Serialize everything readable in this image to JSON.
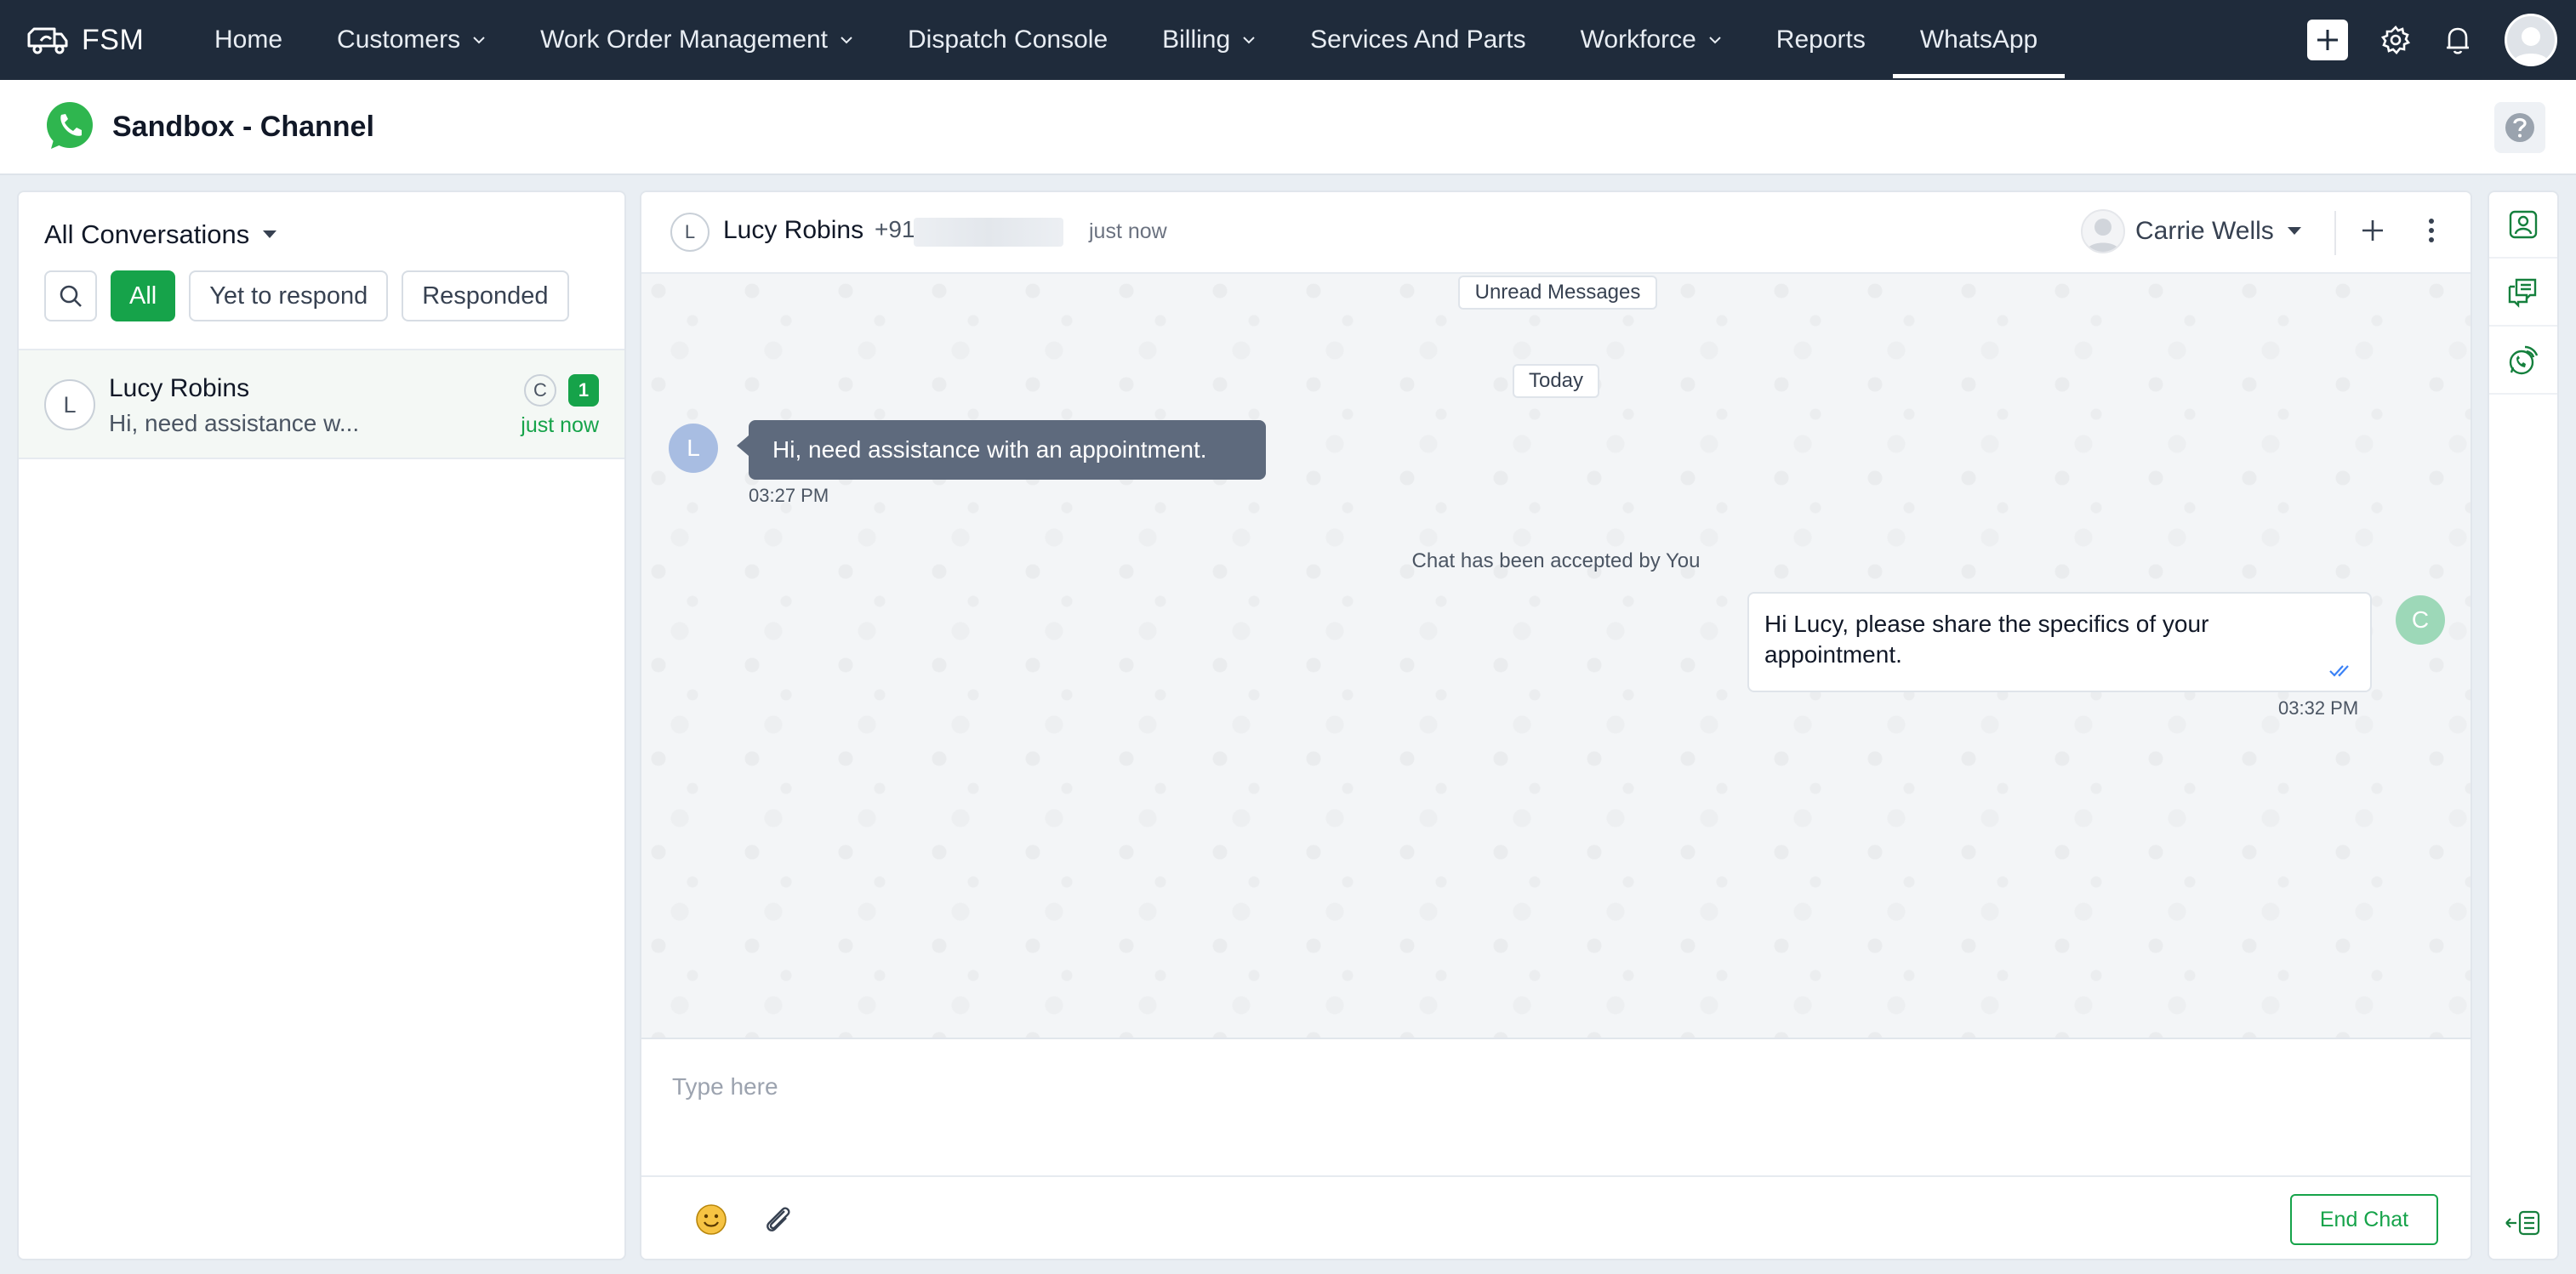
{
  "app": {
    "brand": "FSM",
    "logo_icon": "truck-logo-icon"
  },
  "nav": {
    "items": [
      {
        "label": "Home",
        "has_caret": false
      },
      {
        "label": "Customers",
        "has_caret": true
      },
      {
        "label": "Work Order Management",
        "has_caret": true
      },
      {
        "label": "Dispatch Console",
        "has_caret": false
      },
      {
        "label": "Billing",
        "has_caret": true
      },
      {
        "label": "Services And Parts",
        "has_caret": false
      },
      {
        "label": "Workforce",
        "has_caret": true
      },
      {
        "label": "Reports",
        "has_caret": false
      },
      {
        "label": "WhatsApp",
        "has_caret": false,
        "active": true
      }
    ],
    "right_icons": [
      "plus-icon",
      "gear-icon",
      "bell-icon",
      "avatar"
    ]
  },
  "subheader": {
    "title": "Sandbox - Channel",
    "icon": "whatsapp-icon",
    "help_icon": "help-icon"
  },
  "conversations": {
    "filter_label": "All Conversations",
    "filters": [
      "All",
      "Yet to respond",
      "Responded"
    ],
    "active_filter": "All",
    "items": [
      {
        "initial": "L",
        "name": "Lucy Robins",
        "preview": "Hi, need assistance w...",
        "agent_initial": "C",
        "unread": "1",
        "time": "just now"
      }
    ]
  },
  "chat": {
    "contact": {
      "initial": "L",
      "name": "Lucy Robins",
      "phone_prefix": "+91",
      "time": "just now"
    },
    "assignee": "Carrie Wells",
    "unread_marker": "Unread Messages",
    "date_marker": "Today",
    "messages": [
      {
        "direction": "in",
        "initial": "L",
        "text": "Hi, need assistance with an appointment.",
        "time": "03:27 PM"
      },
      {
        "direction": "system",
        "text": "Chat has been accepted by You"
      },
      {
        "direction": "out",
        "initial": "C",
        "text": "Hi Lucy, please share the specifics of your appointment.",
        "time": "03:32 PM",
        "status": "read"
      }
    ],
    "composer": {
      "placeholder": "Type here",
      "end_chat_label": "End Chat"
    }
  },
  "right_rail": {
    "icons": [
      "contact-icon",
      "chat-notes-icon",
      "whatsapp-template-icon",
      "collapse-panel-icon"
    ]
  },
  "colors": {
    "nav_bg": "#1f2b3b",
    "accent_green": "#16a34a",
    "incoming_bubble": "#5e6a7d"
  }
}
